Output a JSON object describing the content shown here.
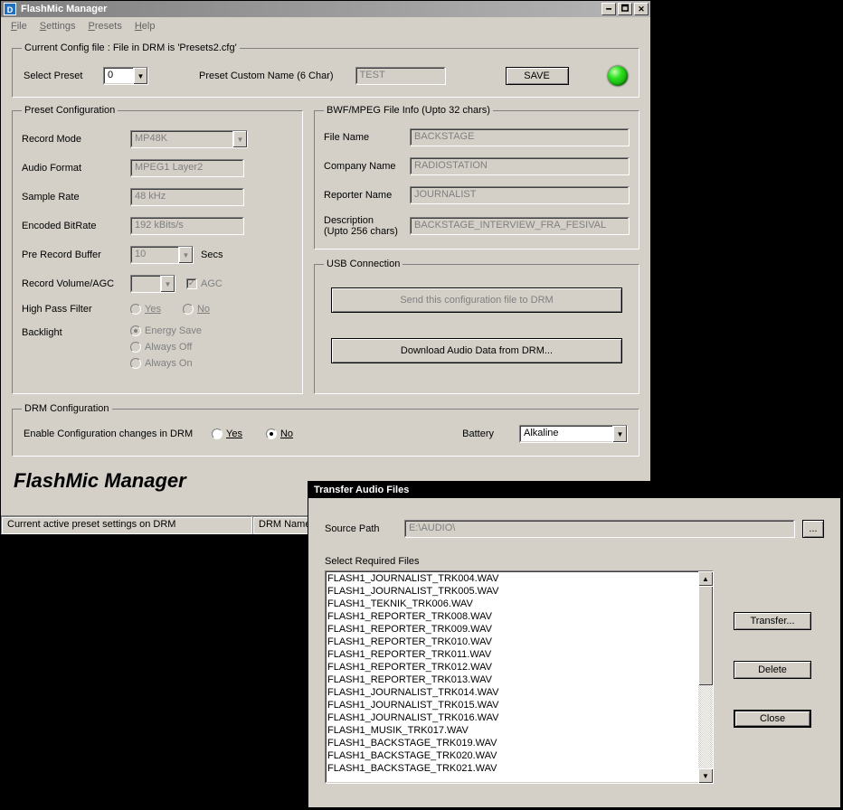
{
  "main": {
    "title": "FlashMic Manager",
    "menu": {
      "file": "File",
      "settings": "Settings",
      "presets": "Presets",
      "help": "Help"
    },
    "config_legend": "Current Config file : File in DRM is 'Presets2.cfg'",
    "select_preset_label": "Select Preset",
    "select_preset_value": "0",
    "custom_name_label": "Preset Custom Name (6 Char)",
    "custom_name_value": "TEST",
    "save_label": "SAVE",
    "preset_conf": {
      "legend": "Preset Configuration",
      "record_mode_label": "Record Mode",
      "record_mode_value": "MP48K",
      "audio_format_label": "Audio Format",
      "audio_format_value": "MPEG1 Layer2",
      "sample_rate_label": "Sample Rate",
      "sample_rate_value": "48 kHz",
      "bitrate_label": "Encoded BitRate",
      "bitrate_value": "192 kBits/s",
      "prerec_label": "Pre Record Buffer",
      "prerec_value": "10",
      "prerec_unit": "Secs",
      "vol_label": "Record Volume/AGC",
      "vol_value": "",
      "agc_label": "AGC",
      "hpf_label": "High Pass Filter",
      "hpf_yes": "Yes",
      "hpf_no": "No",
      "backlight_label": "Backlight",
      "bl_energy": "Energy Save",
      "bl_off": "Always Off",
      "bl_on": "Always On"
    },
    "bwf": {
      "legend": "BWF/MPEG File Info (Upto 32 chars)",
      "file_name_label": "File Name",
      "file_name_value": "BACKSTAGE",
      "company_label": "Company Name",
      "company_value": "RADIOSTATION",
      "reporter_label": "Reporter Name",
      "reporter_value": "JOURNALIST",
      "desc_label": "Description",
      "desc_sub": "(Upto 256 chars)",
      "desc_value": "BACKSTAGE_INTERVIEW_FRA_FESIVAL"
    },
    "usb": {
      "legend": "USB Connection",
      "send_label": "Send this configuration file to DRM",
      "download_label": "Download Audio Data from DRM..."
    },
    "drm": {
      "legend": "DRM Configuration",
      "enable_label": "Enable Configuration changes in DRM",
      "yes": "Yes",
      "no": "No",
      "battery_label": "Battery",
      "battery_value": "Alkaline"
    },
    "brand": "FlashMic Manager",
    "status": {
      "cell1": "Current active preset settings on DRM",
      "cell2": "DRM Name"
    }
  },
  "transfer": {
    "title": "Transfer Audio Files",
    "source_label": "Source Path",
    "source_value": "E:\\AUDIO\\",
    "browse": "...",
    "select_label": "Select Required Files",
    "files": [
      "FLASH1_JOURNALIST_TRK004.WAV",
      "FLASH1_JOURNALIST_TRK005.WAV",
      "FLASH1_TEKNIK_TRK006.WAV",
      "FLASH1_REPORTER_TRK008.WAV",
      "FLASH1_REPORTER_TRK009.WAV",
      "FLASH1_REPORTER_TRK010.WAV",
      "FLASH1_REPORTER_TRK011.WAV",
      "FLASH1_REPORTER_TRK012.WAV",
      "FLASH1_REPORTER_TRK013.WAV",
      "FLASH1_JOURNALIST_TRK014.WAV",
      "FLASH1_JOURNALIST_TRK015.WAV",
      "FLASH1_JOURNALIST_TRK016.WAV",
      "FLASH1_MUSIK_TRK017.WAV",
      "FLASH1_BACKSTAGE_TRK019.WAV",
      "FLASH1_BACKSTAGE_TRK020.WAV",
      "FLASH1_BACKSTAGE_TRK021.WAV"
    ],
    "transfer_btn": "Transfer...",
    "delete_btn": "Delete",
    "close_btn": "Close"
  }
}
